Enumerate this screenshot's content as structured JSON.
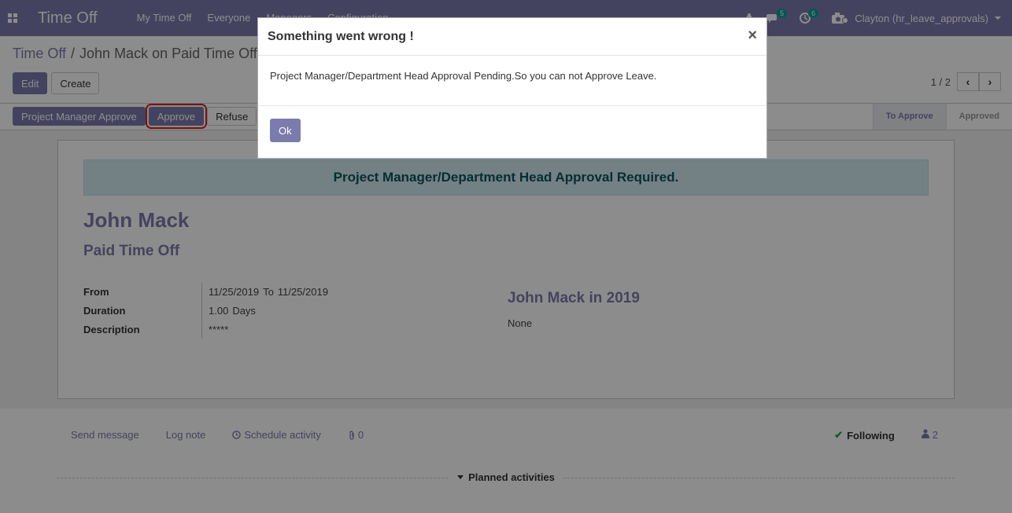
{
  "navbar": {
    "app_title": "Time Off",
    "menu": [
      "My Time Off",
      "Everyone",
      "Managers",
      "Configuration"
    ],
    "messages_count": "5",
    "activities_count": "6",
    "user": "Clayton (hr_leave_approvals)"
  },
  "breadcrumb": {
    "parent": "Time Off",
    "separator": "/",
    "current": "John Mack on Paid Time Off"
  },
  "toolbar": {
    "edit_label": "Edit",
    "create_label": "Create"
  },
  "pager": {
    "value": "1 / 2",
    "prev": "‹",
    "next": "›"
  },
  "statusbar": {
    "pm_approve_label": "Project Manager Approve",
    "approve_label": "Approve",
    "refuse_label": "Refuse",
    "stages": [
      "To Approve",
      "Approved"
    ],
    "active_stage": "To Approve"
  },
  "form": {
    "alert": "Project Manager/Department Head Approval Required.",
    "employee": "John Mack",
    "leave_type": "Paid Time Off",
    "fields": {
      "from_label": "From",
      "from_date": "11/25/2019",
      "to_word": "To",
      "to_date": "11/25/2019",
      "duration_label": "Duration",
      "duration_value": "1.00",
      "duration_unit": "Days",
      "description_label": "Description",
      "description_value": "*****"
    },
    "side_title": "John Mack in 2019",
    "side_value": "None"
  },
  "chatter": {
    "send_message": "Send message",
    "log_note": "Log note",
    "schedule_activity": "Schedule activity",
    "attachments": "0",
    "following": "Following",
    "followers": "2",
    "planned_activities": "Planned activities"
  },
  "modal": {
    "title": "Something went wrong !",
    "close": "×",
    "message": "Project Manager/Department Head Approval Pending.So you can not Approve Leave.",
    "ok_label": "Ok"
  },
  "colors": {
    "brand": "#7c7bad",
    "alert_bg": "#d2eaf1",
    "highlight": "#e02020"
  }
}
